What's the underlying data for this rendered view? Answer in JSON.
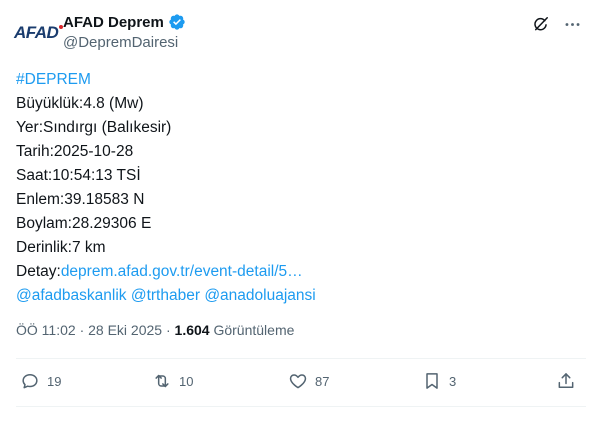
{
  "author": {
    "logo_text": "AFAD",
    "display_name": "AFAD Deprem",
    "handle": "@DepremDairesi",
    "verified_icon": "verified-badge-icon"
  },
  "top_actions": {
    "grok_icon": "grok-icon",
    "more_icon": "more-icon"
  },
  "body": {
    "hashtag": "#DEPREM",
    "lines": [
      "Büyüklük:4.8 (Mw)",
      "Yer:Sındırgı (Balıkesir)",
      "Tarih:2025-10-28",
      "Saat:10:54:13 TSİ",
      "Enlem:39.18583 N",
      "Boylam:28.29306 E",
      "Derinlik:7 km"
    ],
    "detail_label": "Detay:",
    "detail_link": "deprem.afad.gov.tr/event-detail/5…",
    "mentions": [
      "@afadbaskanlik",
      "@trthaber",
      "@anadoluajansi"
    ]
  },
  "meta": {
    "time": "ÖÖ 11:02",
    "sep": "·",
    "date": "28 Eki 2025",
    "views_count": "1.604",
    "views_label": "Görüntüleme"
  },
  "actions": {
    "replies": "19",
    "retweets": "10",
    "likes": "87",
    "bookmarks": "3"
  },
  "colors": {
    "link": "#1d9bf0",
    "muted": "#536471",
    "verified": "#1d9bf0"
  }
}
